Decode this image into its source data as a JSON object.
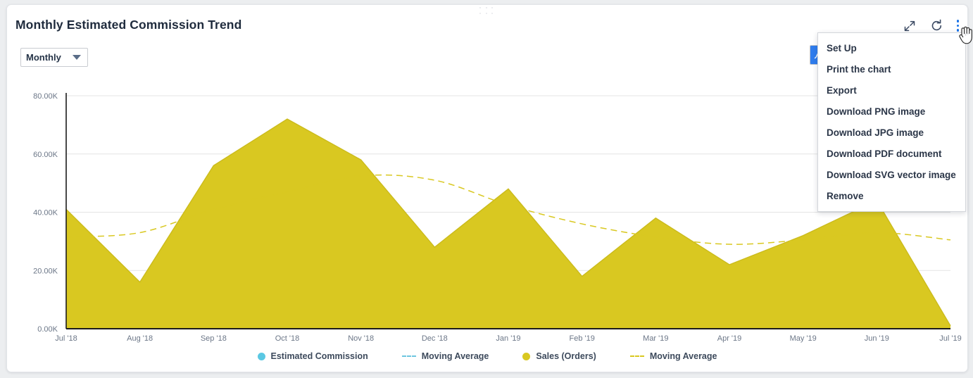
{
  "card": {
    "title": "Monthly Estimated Commission Trend",
    "drag_handle": "drag-handle"
  },
  "period_filter": {
    "selected": "Monthly",
    "options": [
      "Monthly"
    ]
  },
  "toolbar": {
    "expand_label": "Expand",
    "refresh_label": "Refresh",
    "more_label": "More options"
  },
  "menu": {
    "items": [
      {
        "label": "Set Up"
      },
      {
        "label": "Print the chart"
      },
      {
        "label": "Export"
      },
      {
        "label": "Download PNG image"
      },
      {
        "label": "Download JPG image"
      },
      {
        "label": "Download PDF document"
      },
      {
        "label": "Download SVG vector image"
      },
      {
        "label": "Remove"
      }
    ]
  },
  "colors": {
    "sales_fill": "#d9c821",
    "sales_line": "#cbbb1c",
    "commission": "#5bc8e3",
    "accent_blue": "#1a73e8",
    "axis": "#1b1b1b",
    "grid": "#e4e4e4",
    "text": "#3d4a5c"
  },
  "legend": [
    {
      "label": "Estimated Commission",
      "marker": "dot",
      "color": "#5bc8e3"
    },
    {
      "label": "Moving Average",
      "marker": "dash",
      "color": "#6ec6e0"
    },
    {
      "label": "Sales (Orders)",
      "marker": "dot",
      "color": "#d9c821"
    },
    {
      "label": "Moving Average",
      "marker": "dash",
      "color": "#d9c821"
    }
  ],
  "chart_data": {
    "type": "area",
    "title": "Monthly Estimated Commission Trend",
    "xlabel": "",
    "ylabel": "",
    "ylim": [
      0,
      80000
    ],
    "grid": true,
    "legend_position": "bottom",
    "y_ticks": [
      0,
      20000,
      40000,
      60000,
      80000
    ],
    "y_tick_labels": [
      "0.00K",
      "20.00K",
      "40.00K",
      "60.00K",
      "80.00K"
    ],
    "categories": [
      "Jul '18",
      "Aug '18",
      "Sep '18",
      "Oct '18",
      "Nov '18",
      "Dec '18",
      "Jan '19",
      "Feb '19",
      "Mar '19",
      "Apr '19",
      "May '19",
      "Jun '19",
      "Jul '19"
    ],
    "series": [
      {
        "name": "Sales (Orders)",
        "type": "area",
        "color": "#d9c821",
        "values": [
          41000,
          16000,
          56000,
          72000,
          58000,
          28000,
          48000,
          18000,
          38000,
          22000,
          32000,
          44000,
          1000
        ]
      },
      {
        "name": "Moving Average",
        "type": "line-dashed",
        "color": "#d9c821",
        "values": [
          31500,
          33000,
          41000,
          47000,
          52500,
          51000,
          42500,
          36000,
          31500,
          29000,
          30500,
          33000,
          30500
        ]
      },
      {
        "name": "Estimated Commission",
        "type": "area",
        "color": "#5bc8e3",
        "values": [
          0,
          0,
          0,
          0,
          0,
          0,
          0,
          0,
          0,
          0,
          0,
          0,
          0
        ]
      },
      {
        "name": "Moving Average",
        "type": "line-dashed",
        "color": "#6ec6e0",
        "values": [
          0,
          0,
          0,
          0,
          0,
          0,
          0,
          0,
          0,
          0,
          0,
          0,
          0
        ]
      }
    ]
  }
}
